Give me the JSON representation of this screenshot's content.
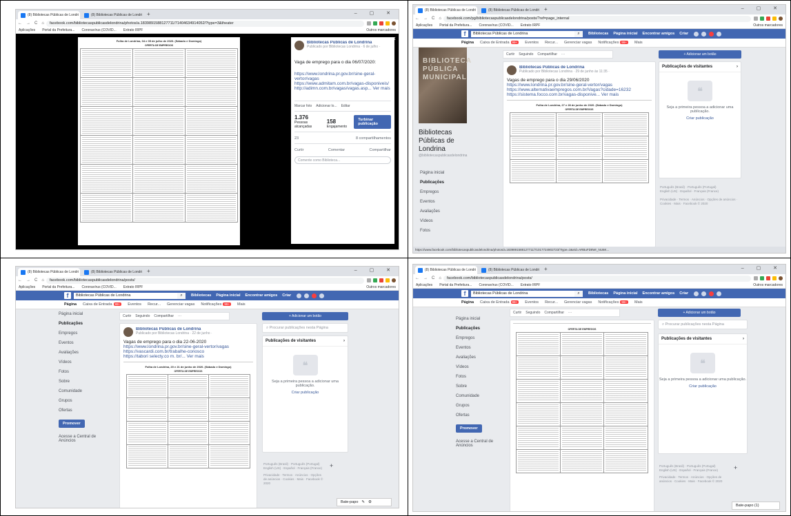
{
  "browser": {
    "tab_active": "(8) Bibliotecas Públicas de Londri",
    "tab_second": "(8) Bibliotecas Públicas de Londri",
    "bookmarks": [
      "Aplicações",
      "Portal da Prefeitura...",
      "Coronavírus (COVID...",
      "Extrato IRPF"
    ],
    "bookmarks_other": "Outros marcadores",
    "url_p1": "facebook.com/bibliotecaspublicasdelondrina/photos/a.1839891588127711/71404634914052/?type=3&theater",
    "url_p2": "facebook.com/pg/bibliotecaspublicasdelondrina/posts/?ref=page_internal",
    "url_p3": "facebook.com/bibliotecaspublicasdelondrina/posts/",
    "url_p4": "facebook.com/bibliotecaspublicasdelondrina/posts/"
  },
  "fb": {
    "search_value": "Bibliotecas Públicas de Londrina",
    "nav_links": [
      "Bibliotecas",
      "Página inicial",
      "Encontrar amigos",
      "Criar"
    ],
    "page_tabs": [
      "Página",
      "Caixa de Entrada",
      "Eventos",
      "Recur...",
      "Gerenciar vagas",
      "Notificações",
      "Mais"
    ],
    "badge_inbox": "99+",
    "badge_notif": "99+",
    "left_nav": [
      "Página inicial",
      "Publicações",
      "Empregos",
      "Eventos",
      "Avaliações",
      "Vídeos",
      "Fotos",
      "Sobre",
      "Comunidade",
      "Grupos",
      "Ofertas"
    ],
    "promote": "Promover",
    "ads_center": "Acesse a Central de Anúncios",
    "curtir": "Curtir",
    "seguindo": "Seguindo",
    "compartilhar": "Compartilhar",
    "add_button": "+ Adicionar um botão",
    "search_posts": "Procurar publicações nesta Página",
    "visitor_posts": "Publicações de visitantes",
    "visitor_empty": "Seja a primeira pessoa a adicionar uma publicação.",
    "create_post": "Criar publicação",
    "lang_line1": "Português (Brasil) · Português (Portugal)",
    "lang_line2": "English (US) · Español · Français (France)",
    "footer": "Privacidade · Termos · Anúncios · Opções de anúncios · Cookies · Mais · Facebook © 2020",
    "chat": "Bate-papo",
    "chat_count": "Bate-papo (1)",
    "page_name": "Bibliotecas Públicas de Londrina",
    "page_handle": "@bibliotecaspublicasdelondrina",
    "cover_text": "BIBLIOTECA PÚBLICA MUNICIPAL"
  },
  "p1": {
    "doc_title": "Folha de Londrina, 04 e 05 de julho de 2020. (Sábado e Domingo)",
    "doc_sub": "OFERTA DE EMPREGOS",
    "post_author": "Bibliotecas Públicas de Londrina",
    "post_meta": "Publicado por Bibliotecas Londrina · 6 de julho ·",
    "post_text": "Vaga de emprego para o dia 06/07/2020:",
    "links": [
      "https://www.londrina.pr.gov.br/sine-geral-",
      "vertor/vagas",
      "https://www.admitam.com.br/vagas-disponiveis/",
      "http://adimn.com.br/vagas/vagas.asp... Ver mais"
    ],
    "tag_photo": "Marcar foto",
    "add_location": "Adicionar lo...",
    "edit": "Editar",
    "people_reached": "1.376",
    "people_reached_label": "Pessoas alcançadas",
    "engagement": "158",
    "engagement_label": "Engajamento",
    "boost": "Turbinar publicação",
    "reactions_count": "23",
    "shares": "8 compartilhamentos",
    "comment_placeholder": "Comente como Biblioteca..."
  },
  "p2": {
    "post_meta": "Publicado por Bibliotecas Londrina · 29 de junho às 11:35 ·",
    "post_text": "Vagas de emprego para o dia 29/06/2020",
    "links": [
      "https://www.londrina.pr.gov.br/sine-geral-vertor/vagas",
      "https://www.alternativaempregos.com.br/Vagas?cidade=16232",
      "https://sistema.focco.com.br/vagas-disponive... Ver mais"
    ],
    "doc_title": "Folha de Londrina, 27 e 28 de junho de 2020. (Sábado e Domingo)",
    "doc_sub": "OFERTA DE EMPREGOS",
    "status_url": "https://www.facebook.com/bibliotecaspublicasdelondrina/photos/a.1839891588127711/71017724902723/?type=3&eid=ARBuFD8Wr_NU6K..."
  },
  "p3": {
    "post_meta": "Publicado por Bibliotecas Londrina · 22 de junho ·",
    "post_text": "Vagas de emprego para o dia 22-06-2020",
    "links": [
      "https://www.londrina.pr.gov.br/sine-geral-vertor/vagas",
      "https://vascardi.com.br/trabalhe-conosco",
      "https://tabori selecty.co m. br/... Ver mais"
    ],
    "doc_title": "Folha de Londrina, 20 e 21 de junho de 2020. (Sábado e Domingo)",
    "doc_sub": "OFERTA DE EMPREGOS"
  },
  "p4": {
    "doc_sub": "OFERTA DE EMPREGOS"
  }
}
